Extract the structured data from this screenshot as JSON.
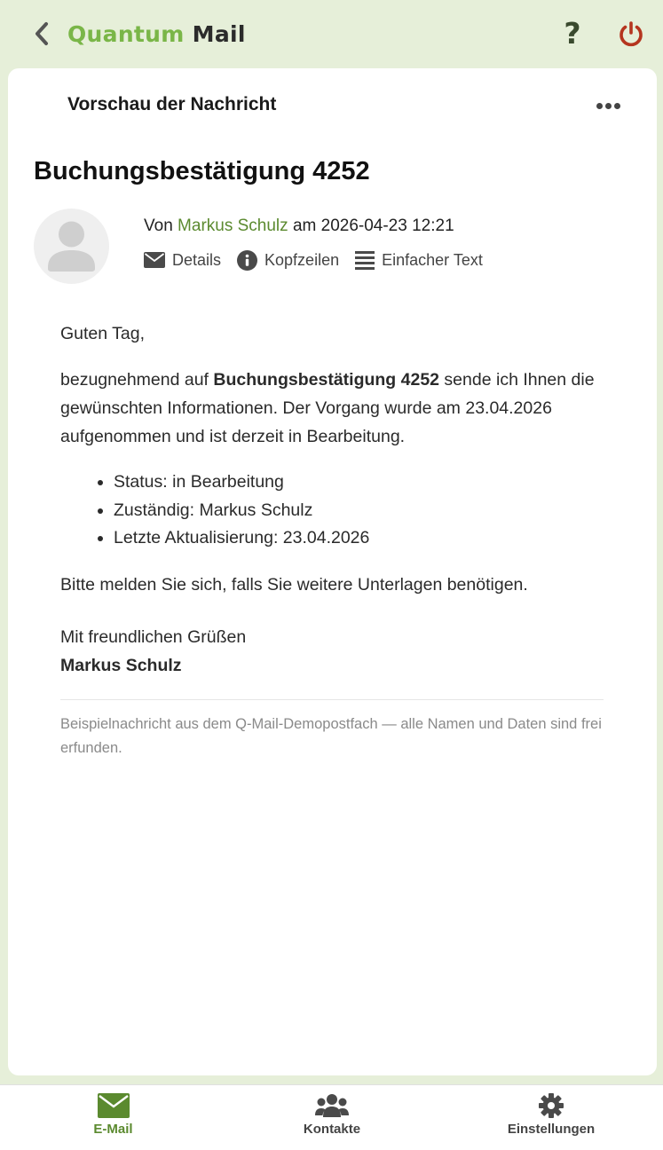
{
  "header": {
    "title_accent": "Quantum",
    "title_rest": "Mail",
    "help_label": "?",
    "colors": {
      "accent": "#7ab648",
      "power": "#b5351f",
      "background": "#e6efd9"
    }
  },
  "preview": {
    "heading": "Vorschau der Nachricht",
    "subject": "Buchungsbestätigung 4252",
    "meta": {
      "from_prefix": "Von",
      "sender": "Markus Schulz",
      "date_prefix": "am",
      "datetime": "2026-04-23 12:21"
    },
    "actions": [
      {
        "label": "Details",
        "icon": "envelope-icon"
      },
      {
        "label": "Kopfzeilen",
        "icon": "info-icon"
      },
      {
        "label": "Einfacher Text",
        "icon": "list-lines-icon"
      }
    ]
  },
  "message": {
    "greeting": "Guten Tag,",
    "intro_before": "bezugnehmend auf ",
    "intro_bold": "Buchungsbestätigung 4252",
    "intro_after": " sende ich Ihnen die gewünschten Informationen. Der Vorgang wurde am 23.04.2026 aufgenommen und ist derzeit in Bearbeitung.",
    "bullets": [
      "Status: in Bearbeitung",
      "Zuständig: Markus Schulz",
      "Letzte Aktualisierung: 23.04.2026"
    ],
    "closing": "Bitte melden Sie sich, falls Sie weitere Unterlagen benötigen.",
    "signature_greeting": "Mit freundlichen Grüßen",
    "signature_name": "Markus Schulz",
    "disclaimer": "Beispielnachricht aus dem Q-Mail-Demopostfach — alle Namen und Daten sind frei erfunden."
  },
  "nav": {
    "items": [
      {
        "label": "E-Mail",
        "icon": "envelope-icon",
        "active": true
      },
      {
        "label": "Kontakte",
        "icon": "users-icon",
        "active": false
      },
      {
        "label": "Einstellungen",
        "icon": "gear-icon",
        "active": false
      }
    ]
  }
}
